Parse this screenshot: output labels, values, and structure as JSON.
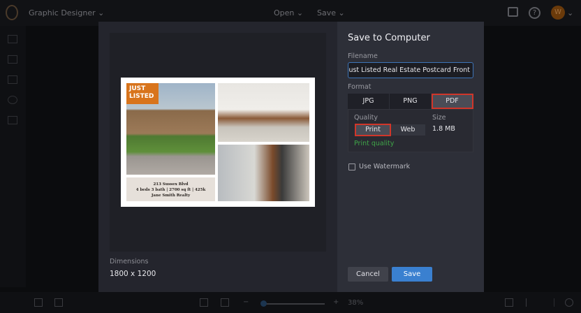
{
  "topbar": {
    "app_name": "Graphic Designer",
    "chevron": "⌄",
    "open": "Open",
    "save": "Save",
    "help": "?",
    "avatar_initial": "W"
  },
  "bottombar": {
    "zoom_minus": "−",
    "zoom_plus": "+",
    "zoom_level": "38%",
    "zoom_fraction": 0.03
  },
  "dialog": {
    "title": "Save to Computer",
    "filename_label": "Filename",
    "filename_value": "Just Listed Real Estate Postcard Front",
    "format_label": "Format",
    "formats": [
      "JPG",
      "PNG",
      "PDF"
    ],
    "selected_format": "PDF",
    "quality_label": "Quality",
    "qualities": [
      "Print",
      "Web"
    ],
    "selected_quality": "Print",
    "size_label": "Size",
    "size_value": "1.8 MB",
    "quality_note": "Print quality",
    "watermark_label": "Use Watermark",
    "watermark_checked": false,
    "cancel": "Cancel",
    "save": "Save",
    "dimensions_label": "Dimensions",
    "dimensions_value": "1800 x 1200",
    "highlight_color": "#d0362a",
    "accent_color": "#3a80d0"
  },
  "postcard": {
    "badge_line1": "JUST",
    "badge_line2": "LISTED",
    "address": "213 Sussex Blvd",
    "details": "4 beds 3 bath | 2700 sq ft | 425k",
    "agent": "Jane Smith Realty"
  }
}
